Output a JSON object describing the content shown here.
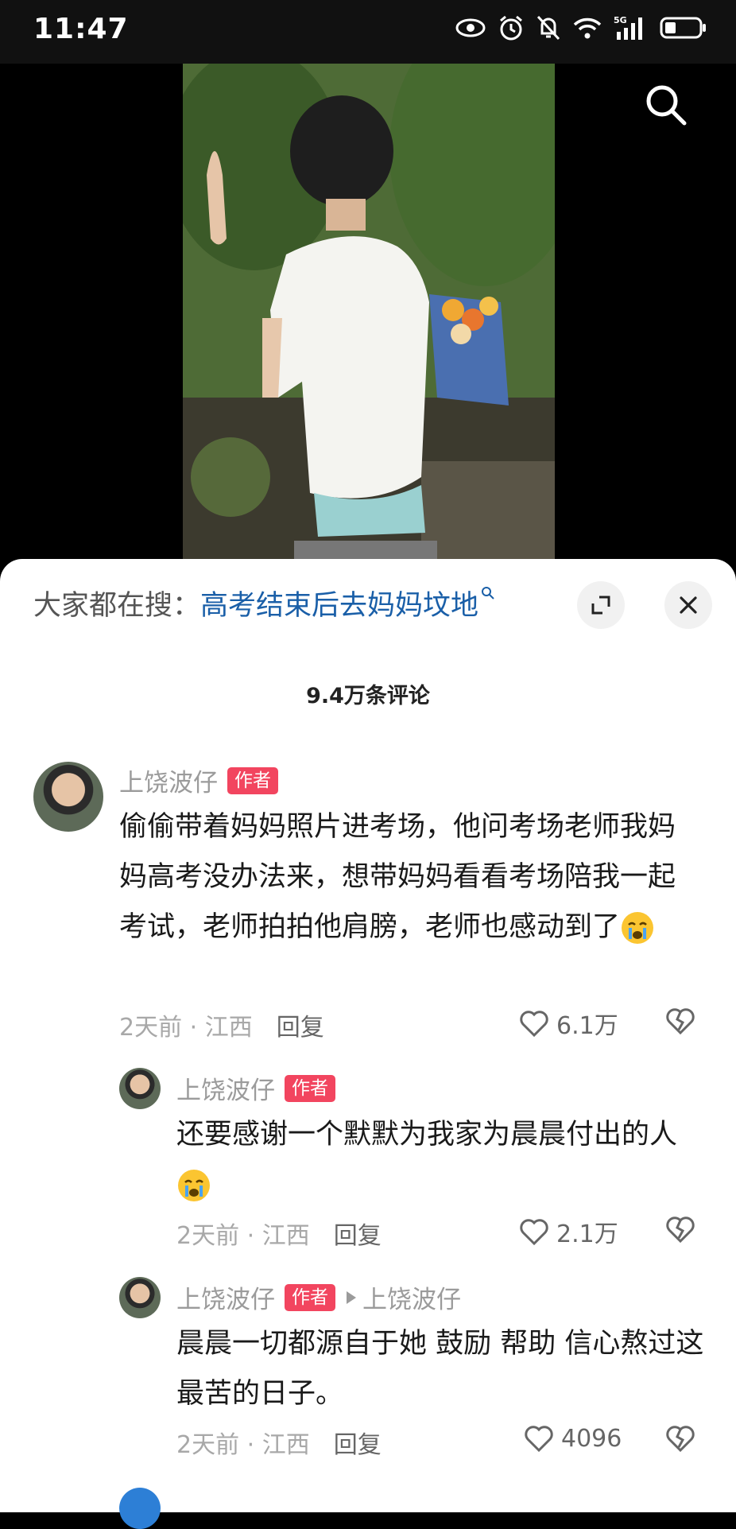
{
  "status_bar": {
    "time": "11:47",
    "network": "5G"
  },
  "trending": {
    "prefix": "大家都在搜：",
    "keyword": "高考结束后去妈妈坟地"
  },
  "comments_header": {
    "count": "9.4万条评论"
  },
  "comments": [
    {
      "user": "上饶波仔",
      "badge": "作者",
      "text": "偷偷带着妈妈照片进考场，他问考场老师我妈妈高考没办法来，想带妈妈看看考场陪我一起考试，老师拍拍他肩膀，老师也感动到了",
      "time": "2天前",
      "location": "江西",
      "reply_label": "回复",
      "likes": "6.1万"
    },
    {
      "user": "上饶波仔",
      "badge": "作者",
      "text": "还要感谢一个默默为我家为晨晨付出的人",
      "time": "2天前",
      "location": "江西",
      "reply_label": "回复",
      "likes": "2.1万"
    },
    {
      "user": "上饶波仔",
      "badge": "作者",
      "reply_to": "上饶波仔",
      "text": "晨晨一切都源自于她 鼓励 帮助 信心熬过这最苦的日子。",
      "time": "2天前",
      "location": "江西",
      "reply_label": "回复",
      "likes": "4096"
    }
  ],
  "icons": [
    "eye-icon",
    "alarm-icon",
    "mute-icon",
    "wifi-icon",
    "signal-icon",
    "battery-icon",
    "search-icon",
    "expand-icon",
    "close-icon",
    "heart-icon",
    "dislike-icon",
    "crying-emoji-icon"
  ]
}
